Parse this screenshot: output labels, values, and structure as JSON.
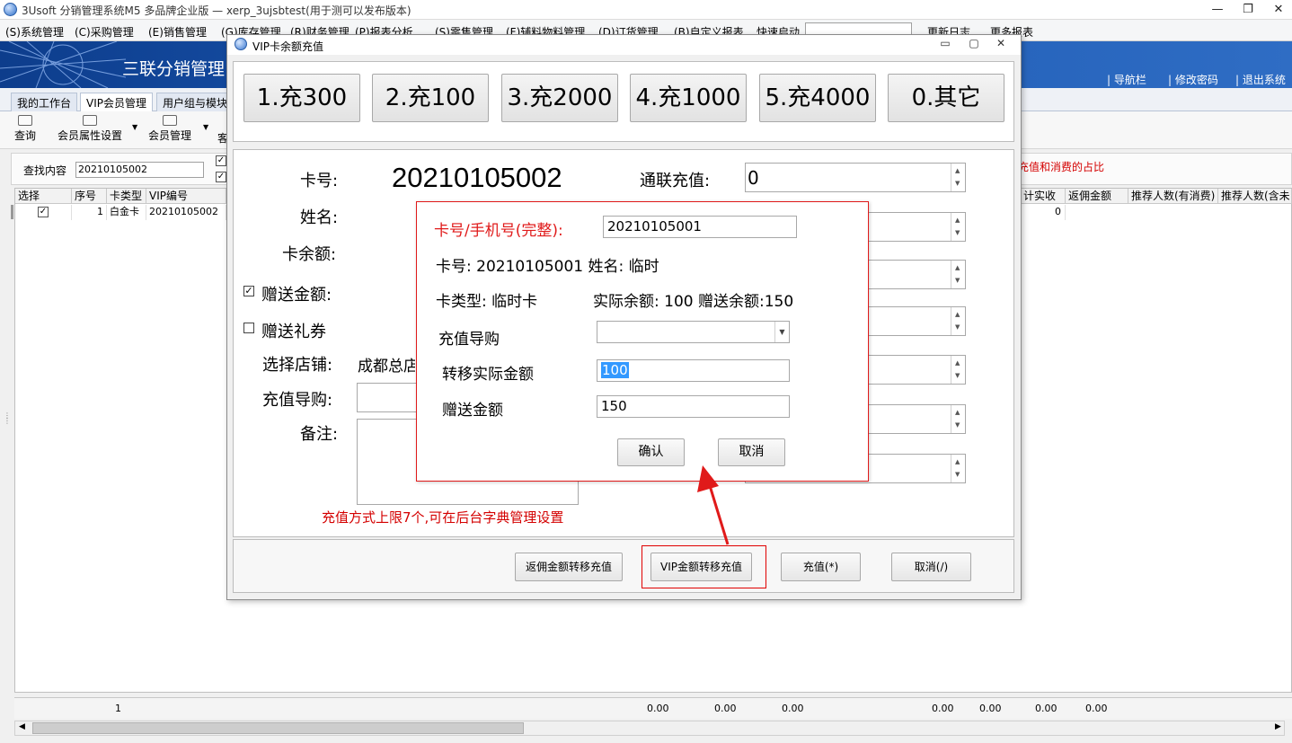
{
  "app": {
    "title": "3Usoft 分销管理系统M5 多品牌企业版 — xerp_3ujsbtest(用于测可以发布版本)",
    "win_controls": [
      "—",
      "❐",
      "✕"
    ]
  },
  "menu": {
    "items": [
      "(S)系统管理",
      "(C)采购管理",
      "(E)销售管理",
      "(G)库存管理",
      "(R)财务管理",
      "(P)报表分析",
      "(S)零售管理",
      "(F)辅料物料管理",
      "(D)订货管理",
      "(B)自定义报表",
      "快速启动",
      "更新日志",
      "更多报表"
    ]
  },
  "banner": {
    "title": "三联分销管理",
    "links": [
      "| 导航栏",
      "| 修改密码",
      "| 退出系统"
    ]
  },
  "tabs": [
    "我的工作台",
    "VIP会员管理",
    "用户组与模块"
  ],
  "toolbar": {
    "query": "查询",
    "member_attr": "会员属性设置",
    "member_mgmt": "会员管理",
    "more": "客"
  },
  "search": {
    "label": "查找内容",
    "value": "20210105002",
    "note": "充值和消费的占比"
  },
  "grid": {
    "headers": [
      "选择",
      "序号",
      "卡类型",
      "VIP编号"
    ],
    "right_headers": [
      "计实收",
      "返佣金额",
      "推荐人数(有消费)",
      "推荐人数(含未"
    ],
    "row": {
      "check": "✓",
      "no": "1",
      "type": "白金卡",
      "vip": "20210105002",
      "right_val": "0"
    }
  },
  "footer": {
    "count": "1",
    "values": [
      "0.00",
      "0.00",
      "0.00",
      "0.00",
      "0.00",
      "0.00",
      "0.00"
    ]
  },
  "dialog": {
    "title": "VIP卡余额充值",
    "controls": [
      "▭",
      "▢",
      "✕"
    ],
    "quick_buttons": [
      "1.充300",
      "2.充100",
      "3.充2000",
      "4.充1000",
      "5.充4000",
      "0.其它"
    ],
    "form": {
      "card_no_label": "卡号:",
      "card_no_value": "20210105002",
      "name_label": "姓名:",
      "balance_label": "卡余额:",
      "gift_amount_label": "赠送金额:",
      "gift_amount_checked": "✓",
      "gift_coupon_label": "赠送礼券",
      "store_label": "选择店铺:",
      "store_value": "成都总店",
      "guide_label": "充值导购:",
      "remark_label": "备注:",
      "union_label": "通联充值:",
      "union_value": "0",
      "limit_note": "充值方式上限7个,可在后台字典管理设置"
    },
    "buttons": {
      "rebate_transfer": "返佣金额转移充值",
      "vip_transfer": "VIP金额转移充值",
      "recharge": "充值(*)",
      "cancel": "取消(/)"
    }
  },
  "popup": {
    "card_phone_label": "卡号/手机号(完整):",
    "card_phone_value": "20210105001",
    "card_info": "卡号: 20210105001 姓名: 临时",
    "card_type": "卡类型: 临时卡",
    "balance_info": "实际余额: 100 赠送余额:150",
    "guide_label": "充值导购",
    "transfer_label": "转移实际金额",
    "transfer_value": "100",
    "gift_label": "赠送金额",
    "gift_value": "150",
    "confirm": "确认",
    "cancel": "取消"
  },
  "colors": {
    "accent_red": "#e01a1a",
    "banner_blue": "#1a56b0"
  }
}
